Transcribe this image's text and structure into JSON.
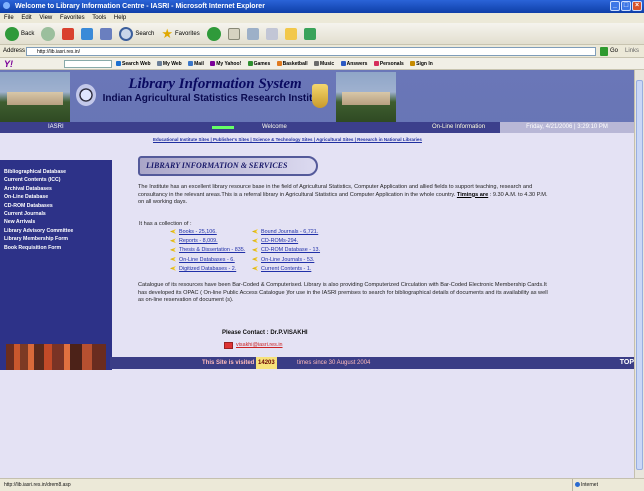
{
  "window": {
    "title": "Welcome to Library Information Centre - IASRI - Microsoft Internet Explorer",
    "controls": [
      "_",
      "□",
      "×"
    ]
  },
  "menubar": [
    "File",
    "Edit",
    "View",
    "Favorites",
    "Tools",
    "Help"
  ],
  "toolbar": {
    "back": "Back",
    "search": "Search",
    "favorites": "Favorites",
    "icons": [
      "back-icon",
      "forward-icon",
      "stop-icon",
      "refresh-icon",
      "home-icon",
      "search-icon",
      "favorites-icon",
      "history-icon",
      "mail-icon",
      "print-icon",
      "edit-icon",
      "messenger-icon"
    ]
  },
  "address": {
    "label": "Address",
    "url": "http://lib.iasri.res.in/",
    "go": "Go",
    "links": "Links"
  },
  "yahoo_bar": {
    "logo": "Y!",
    "items": [
      "Search Web",
      "My Web",
      "Mail",
      "My Yahoo!",
      "Games",
      "Basketball",
      "Music",
      "Answers",
      "Personals",
      "Sign In"
    ]
  },
  "header": {
    "title": "Library Information System",
    "subtitle": "Indian Agricultural Statistics Research Institute",
    "strip_left": "IASRI",
    "strip_middle": "Welcome",
    "strip_right": "On-Line Information",
    "date": "Friday, 4/21/2006 | 3:29:10 PM"
  },
  "top_links": "Educational Institute Sites | Publisher's Sites | Science & Technology Sites | Agricultural Sites | Research in National Libraries",
  "sidebar": {
    "items": [
      "Bibliographical Database",
      "Current Contents (ICC)",
      "Archival Databases",
      "On-Line Database",
      "CD-ROM Databases",
      "Current Journals",
      "New Arrivals",
      "Library Advisory Committee",
      "Library Membership Form",
      "Book Requisition Form"
    ]
  },
  "main": {
    "section_title": "LIBRARY INFORMATION & SERVICES",
    "intro": "The Institute has an excellent library resource base in the field of Agricultural Statistics, Computer Application and allied fields to support teaching, research and consultancy in the relevant areas.This is a referral library in Agricultural Statistics and Computer Application in the whole country.",
    "timings_label": "Timings are",
    "timings_value": ": 9.30 A.M. to 4.30 P.M. on all working days.",
    "collection_intro": "It has a collection of :",
    "collection_left": [
      "Books - 25,106.",
      "Reports - 8,009.",
      "Thesis & Dissertation - 835.",
      "On-Line Databases - 6.",
      "Digitized Databases - 2."
    ],
    "collection_right": [
      "Bound Journals - 6,721.",
      "CD-ROMs-294.",
      "CD-ROM Database - 13.",
      "On-Line Journals - 53.",
      "Current Contents - 1."
    ],
    "paragraph2": "Catalogue of its resources have been Bar-Coded & Computerised. Library is also providing Computerized Circulation with Bar-Coded Electronic Membership Cards.It has developed its OPAC ( On-line Public Access Catalogue )for use in the IASRI premises to search for bibliographical details of documents and its availability as well as on-line reservation of document (s).",
    "contact_label": "Please Contact : Dr.P.VISAKHI",
    "contact_email": "visakhi@iasri.res.in"
  },
  "footer": {
    "prefix": "This Site is visited",
    "count": "14203",
    "suffix": "times since 30 August 2004",
    "end": "TOP"
  },
  "statusbar": {
    "url": "http://lib.iasri.res.in/drem8.asp",
    "zone": "Internet"
  },
  "colors": {
    "header_bg": "#6a77b8",
    "nav_bg": "#2d3288",
    "page_bg": "#e4e2f4",
    "link": "#2030a8"
  }
}
